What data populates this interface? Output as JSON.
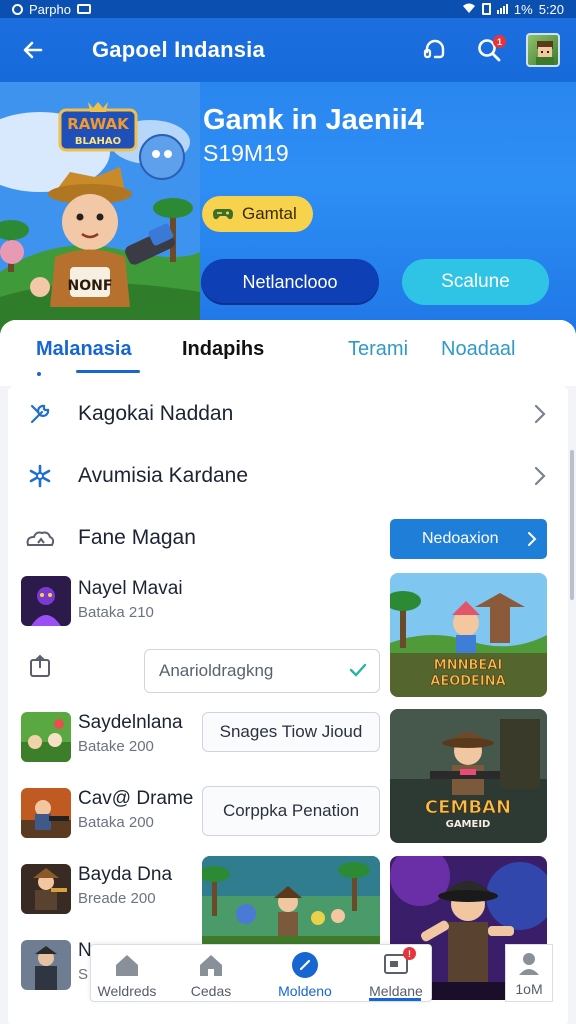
{
  "status_bar": {
    "carrier": "Parpho",
    "signal": "1%",
    "time": "5:20"
  },
  "header": {
    "title": "Gapoel Indansia",
    "notification_count": "1"
  },
  "hero": {
    "logo_top": "RAWAK",
    "logo_bottom": "BLAHAO",
    "character_badge": "NONF",
    "title": "Gamk in Jaenii4",
    "subtitle": "S19M19",
    "chip_label": "Gamtal",
    "primary_button": "Netlanclooo",
    "secondary_button": "Scalune"
  },
  "tabs": [
    {
      "label": "Malanasia"
    },
    {
      "label": "Indapihs"
    },
    {
      "label": "Terami"
    },
    {
      "label": "Noadaal"
    }
  ],
  "menu": {
    "items": [
      {
        "label": "Kagokai Naddan",
        "icon": "wrench-icon"
      },
      {
        "label": "Avumisia Kardane",
        "icon": "starburst-icon"
      },
      {
        "label": "Fane Magan",
        "icon": "cloud-upload-icon",
        "button": "Nedoaxion"
      }
    ]
  },
  "games": [
    {
      "name": "Nayel Mavai",
      "sub": "Bataka 210"
    },
    {
      "name": "Saydelnlana",
      "sub": "Batake 200",
      "action": "Snages Tiow Jioud"
    },
    {
      "name": "Cav@ Drame",
      "sub": "Bataka 200",
      "action": "Corppka Penation"
    },
    {
      "name": "Bayda Dna",
      "sub": "Breade 200"
    },
    {
      "name": "N",
      "sub": "S"
    }
  ],
  "dropdown": {
    "value": "Anarioldragkng"
  },
  "artworks": [
    {
      "title": "MNNBEAI AEODEINA"
    },
    {
      "title": "CEMBAN",
      "subtitle": "GAMEID"
    }
  ],
  "bottom_nav": [
    {
      "label": "Weldreds",
      "icon": "home-icon"
    },
    {
      "label": "Cedas",
      "icon": "house-icon"
    },
    {
      "label": "Moldeno",
      "icon": "compass-icon"
    },
    {
      "label": "Meldane",
      "icon": "message-icon",
      "badge": "!"
    }
  ],
  "profile_tab": {
    "label": "1oM",
    "icon": "person-icon"
  },
  "colors": {
    "primary": "#1766d2",
    "header": "#176ad9",
    "accent_cyan": "#2fc4e6",
    "chip": "#f6d24d"
  }
}
